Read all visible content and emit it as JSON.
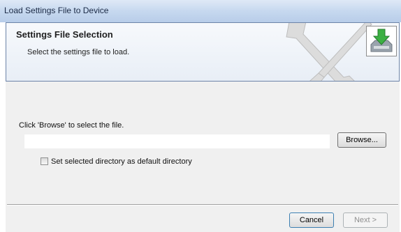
{
  "window": {
    "title": "Load Settings File to Device"
  },
  "header": {
    "title": "Settings File Selection",
    "subtitle": "Select the settings file to load.",
    "decoration_icon": "wrench-screwdriver-icon",
    "install_icon": "download-arrow-icon"
  },
  "main": {
    "instruction": "Click 'Browse' to select the file.",
    "path_value": "",
    "browse_label": "Browse...",
    "default_dir_checkbox": {
      "label": "Set selected directory as default directory",
      "checked": false
    }
  },
  "footer": {
    "cancel_label": "Cancel",
    "next_label": "Next >",
    "next_enabled": false
  },
  "colors": {
    "titlebar": "#c6d8ef",
    "panel": "#f0f0f0",
    "arrow": "#3cb043"
  }
}
